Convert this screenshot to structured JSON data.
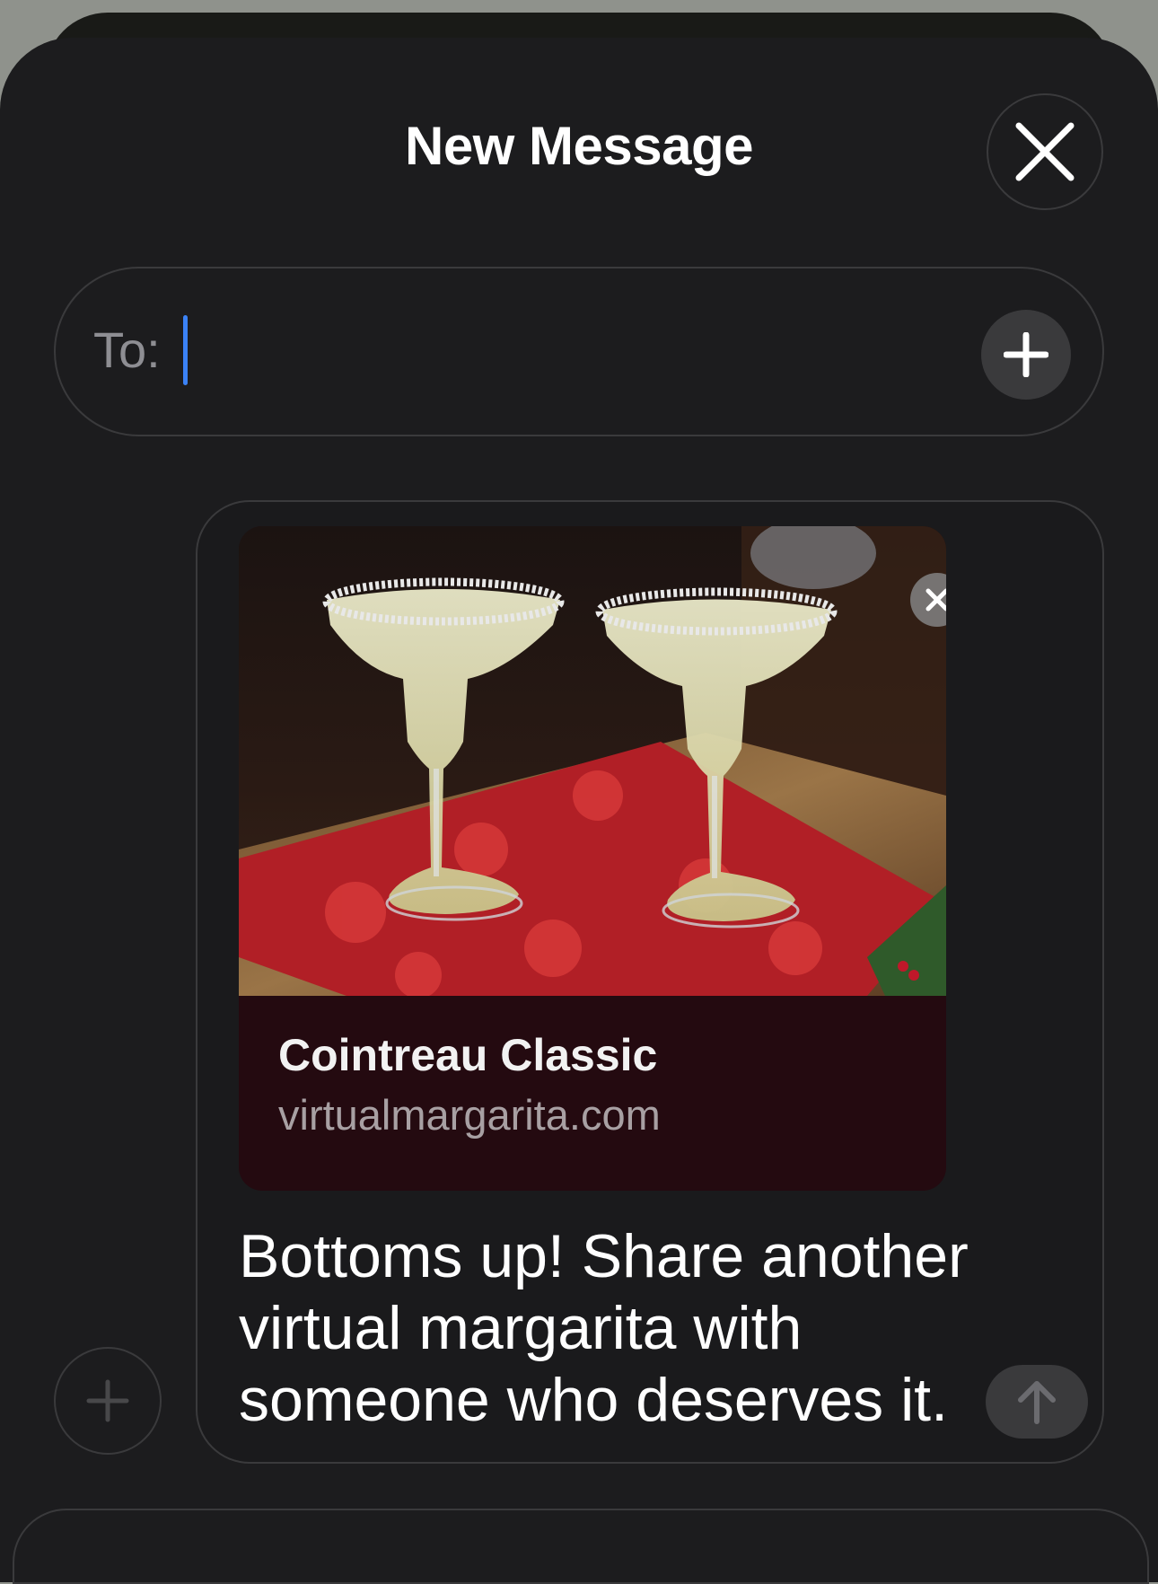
{
  "header": {
    "title": "New Message"
  },
  "recipient": {
    "label": "To:",
    "value": ""
  },
  "link_preview": {
    "title": "Cointreau Classic",
    "domain": "virtualmargarita.com"
  },
  "message": {
    "text": "Bottoms up! Share another virtual margarita with someone who deserves it."
  },
  "icons": {
    "close": "close-icon",
    "add_recipient": "plus-icon",
    "attach": "plus-icon",
    "remove_preview": "close-icon",
    "send": "arrow-up-icon"
  },
  "colors": {
    "background": "#1c1c1e",
    "caret": "#3b82f6",
    "card_footer": "#240a10",
    "button_fill": "#3a3a3c"
  }
}
